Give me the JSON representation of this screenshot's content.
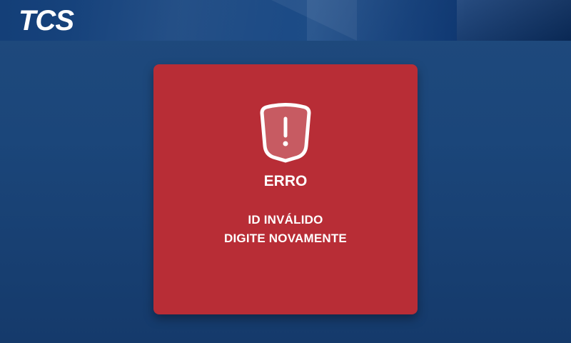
{
  "header": {
    "logo_text": "TCS"
  },
  "dialog": {
    "icon": "shield-alert-icon",
    "title": "ERRO",
    "message_line1": "ID INVÁLIDO",
    "message_line2": "DIGITE NOVAMENTE",
    "background_color": "#b82d36"
  },
  "colors": {
    "background": "#1b467a",
    "header": "#143f78",
    "text": "#ffffff"
  }
}
